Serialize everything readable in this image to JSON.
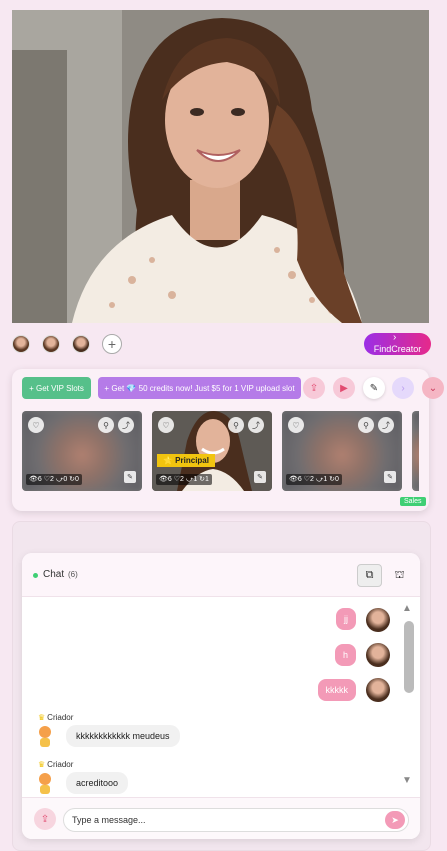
{
  "hero": {
    "alt": "creator photo"
  },
  "avatars": {
    "add_label": "+"
  },
  "find_creator": {
    "label": "FindCreator",
    "chevron": "›"
  },
  "panel": {
    "vip_slots_label": "+ Get VIP Slots",
    "credits_label": "+ Get 💎 50 credits now! Just $5 for 1 VIP upload slot",
    "icons": [
      "upload-icon",
      "video-icon",
      "edit-icon",
      "next-icon",
      "expand-icon"
    ]
  },
  "thumbnails": [
    {
      "stats": "👁6 ♡2 ⤻0 ↻0"
    },
    {
      "stats": "👁6 ♡2 ⤻1 ↻1",
      "badge": "⭐ Principal"
    },
    {
      "stats": "👁6 ♡2 ⤻1 ↻0"
    }
  ],
  "sales_badge": "Sales",
  "chat": {
    "title": "Chat",
    "count": "(6)",
    "messages_right": [
      {
        "text": "jj"
      },
      {
        "text": "h"
      },
      {
        "text": "kkkkk"
      }
    ],
    "messages_left": [
      {
        "author": "Criador",
        "text": "kkkkkkkkkkkk meudeus"
      },
      {
        "author": "Criador",
        "text": "acreditooo"
      }
    ],
    "input_placeholder": "Type a message..."
  },
  "colors": {
    "accent_pink": "#f39ab7",
    "accent_green": "#56c08a",
    "accent_purple": "#b57be8",
    "find_gradient_start": "#9b2ee6",
    "find_gradient_end": "#e6298a"
  }
}
